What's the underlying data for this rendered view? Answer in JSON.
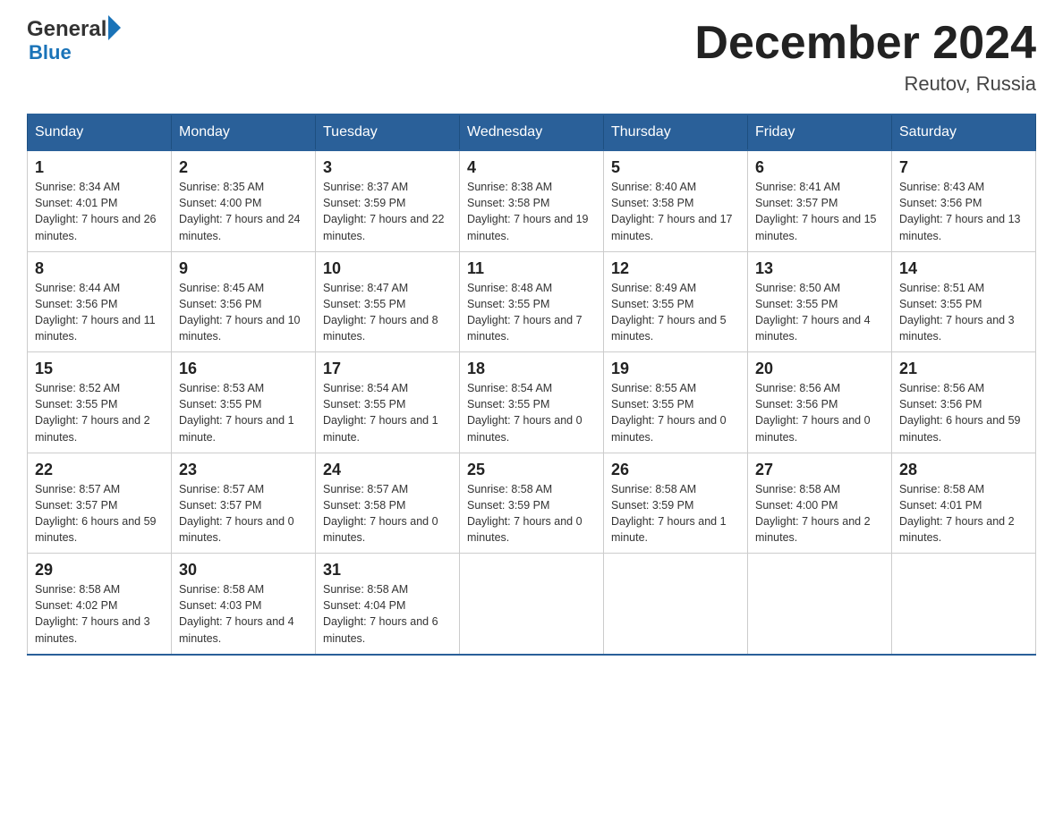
{
  "header": {
    "logo_line1": "General",
    "logo_line2": "Blue",
    "month_title": "December 2024",
    "location": "Reutov, Russia"
  },
  "days_of_week": [
    "Sunday",
    "Monday",
    "Tuesday",
    "Wednesday",
    "Thursday",
    "Friday",
    "Saturday"
  ],
  "weeks": [
    [
      {
        "day": "1",
        "sunrise": "Sunrise: 8:34 AM",
        "sunset": "Sunset: 4:01 PM",
        "daylight": "Daylight: 7 hours and 26 minutes."
      },
      {
        "day": "2",
        "sunrise": "Sunrise: 8:35 AM",
        "sunset": "Sunset: 4:00 PM",
        "daylight": "Daylight: 7 hours and 24 minutes."
      },
      {
        "day": "3",
        "sunrise": "Sunrise: 8:37 AM",
        "sunset": "Sunset: 3:59 PM",
        "daylight": "Daylight: 7 hours and 22 minutes."
      },
      {
        "day": "4",
        "sunrise": "Sunrise: 8:38 AM",
        "sunset": "Sunset: 3:58 PM",
        "daylight": "Daylight: 7 hours and 19 minutes."
      },
      {
        "day": "5",
        "sunrise": "Sunrise: 8:40 AM",
        "sunset": "Sunset: 3:58 PM",
        "daylight": "Daylight: 7 hours and 17 minutes."
      },
      {
        "day": "6",
        "sunrise": "Sunrise: 8:41 AM",
        "sunset": "Sunset: 3:57 PM",
        "daylight": "Daylight: 7 hours and 15 minutes."
      },
      {
        "day": "7",
        "sunrise": "Sunrise: 8:43 AM",
        "sunset": "Sunset: 3:56 PM",
        "daylight": "Daylight: 7 hours and 13 minutes."
      }
    ],
    [
      {
        "day": "8",
        "sunrise": "Sunrise: 8:44 AM",
        "sunset": "Sunset: 3:56 PM",
        "daylight": "Daylight: 7 hours and 11 minutes."
      },
      {
        "day": "9",
        "sunrise": "Sunrise: 8:45 AM",
        "sunset": "Sunset: 3:56 PM",
        "daylight": "Daylight: 7 hours and 10 minutes."
      },
      {
        "day": "10",
        "sunrise": "Sunrise: 8:47 AM",
        "sunset": "Sunset: 3:55 PM",
        "daylight": "Daylight: 7 hours and 8 minutes."
      },
      {
        "day": "11",
        "sunrise": "Sunrise: 8:48 AM",
        "sunset": "Sunset: 3:55 PM",
        "daylight": "Daylight: 7 hours and 7 minutes."
      },
      {
        "day": "12",
        "sunrise": "Sunrise: 8:49 AM",
        "sunset": "Sunset: 3:55 PM",
        "daylight": "Daylight: 7 hours and 5 minutes."
      },
      {
        "day": "13",
        "sunrise": "Sunrise: 8:50 AM",
        "sunset": "Sunset: 3:55 PM",
        "daylight": "Daylight: 7 hours and 4 minutes."
      },
      {
        "day": "14",
        "sunrise": "Sunrise: 8:51 AM",
        "sunset": "Sunset: 3:55 PM",
        "daylight": "Daylight: 7 hours and 3 minutes."
      }
    ],
    [
      {
        "day": "15",
        "sunrise": "Sunrise: 8:52 AM",
        "sunset": "Sunset: 3:55 PM",
        "daylight": "Daylight: 7 hours and 2 minutes."
      },
      {
        "day": "16",
        "sunrise": "Sunrise: 8:53 AM",
        "sunset": "Sunset: 3:55 PM",
        "daylight": "Daylight: 7 hours and 1 minute."
      },
      {
        "day": "17",
        "sunrise": "Sunrise: 8:54 AM",
        "sunset": "Sunset: 3:55 PM",
        "daylight": "Daylight: 7 hours and 1 minute."
      },
      {
        "day": "18",
        "sunrise": "Sunrise: 8:54 AM",
        "sunset": "Sunset: 3:55 PM",
        "daylight": "Daylight: 7 hours and 0 minutes."
      },
      {
        "day": "19",
        "sunrise": "Sunrise: 8:55 AM",
        "sunset": "Sunset: 3:55 PM",
        "daylight": "Daylight: 7 hours and 0 minutes."
      },
      {
        "day": "20",
        "sunrise": "Sunrise: 8:56 AM",
        "sunset": "Sunset: 3:56 PM",
        "daylight": "Daylight: 7 hours and 0 minutes."
      },
      {
        "day": "21",
        "sunrise": "Sunrise: 8:56 AM",
        "sunset": "Sunset: 3:56 PM",
        "daylight": "Daylight: 6 hours and 59 minutes."
      }
    ],
    [
      {
        "day": "22",
        "sunrise": "Sunrise: 8:57 AM",
        "sunset": "Sunset: 3:57 PM",
        "daylight": "Daylight: 6 hours and 59 minutes."
      },
      {
        "day": "23",
        "sunrise": "Sunrise: 8:57 AM",
        "sunset": "Sunset: 3:57 PM",
        "daylight": "Daylight: 7 hours and 0 minutes."
      },
      {
        "day": "24",
        "sunrise": "Sunrise: 8:57 AM",
        "sunset": "Sunset: 3:58 PM",
        "daylight": "Daylight: 7 hours and 0 minutes."
      },
      {
        "day": "25",
        "sunrise": "Sunrise: 8:58 AM",
        "sunset": "Sunset: 3:59 PM",
        "daylight": "Daylight: 7 hours and 0 minutes."
      },
      {
        "day": "26",
        "sunrise": "Sunrise: 8:58 AM",
        "sunset": "Sunset: 3:59 PM",
        "daylight": "Daylight: 7 hours and 1 minute."
      },
      {
        "day": "27",
        "sunrise": "Sunrise: 8:58 AM",
        "sunset": "Sunset: 4:00 PM",
        "daylight": "Daylight: 7 hours and 2 minutes."
      },
      {
        "day": "28",
        "sunrise": "Sunrise: 8:58 AM",
        "sunset": "Sunset: 4:01 PM",
        "daylight": "Daylight: 7 hours and 2 minutes."
      }
    ],
    [
      {
        "day": "29",
        "sunrise": "Sunrise: 8:58 AM",
        "sunset": "Sunset: 4:02 PM",
        "daylight": "Daylight: 7 hours and 3 minutes."
      },
      {
        "day": "30",
        "sunrise": "Sunrise: 8:58 AM",
        "sunset": "Sunset: 4:03 PM",
        "daylight": "Daylight: 7 hours and 4 minutes."
      },
      {
        "day": "31",
        "sunrise": "Sunrise: 8:58 AM",
        "sunset": "Sunset: 4:04 PM",
        "daylight": "Daylight: 7 hours and 6 minutes."
      },
      null,
      null,
      null,
      null
    ]
  ]
}
